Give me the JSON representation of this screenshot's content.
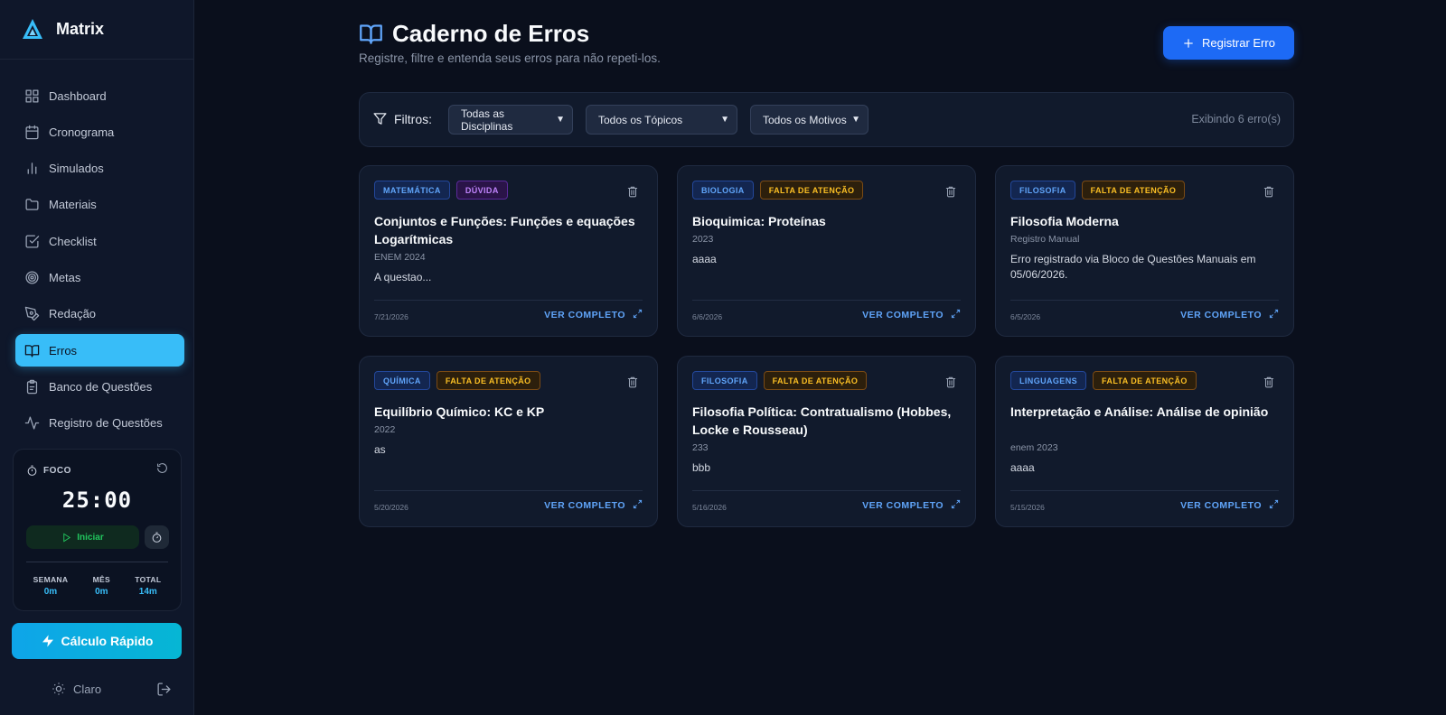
{
  "brand": {
    "name": "Matrix"
  },
  "sidebar": {
    "items": [
      {
        "label": "Dashboard",
        "icon": "dashboard-icon",
        "active": false
      },
      {
        "label": "Cronograma",
        "icon": "calendar-icon",
        "active": false
      },
      {
        "label": "Simulados",
        "icon": "bar-chart-icon",
        "active": false
      },
      {
        "label": "Materiais",
        "icon": "folder-icon",
        "active": false
      },
      {
        "label": "Checklist",
        "icon": "checklist-icon",
        "active": false
      },
      {
        "label": "Metas",
        "icon": "target-icon",
        "active": false
      },
      {
        "label": "Redação",
        "icon": "pen-icon",
        "active": false
      },
      {
        "label": "Erros",
        "icon": "book-icon",
        "active": true
      },
      {
        "label": "Banco de Questões",
        "icon": "clipboard-icon",
        "active": false
      },
      {
        "label": "Registro de Questões",
        "icon": "activity-icon",
        "active": false
      }
    ]
  },
  "focus": {
    "title": "FOCO",
    "timer": "25:00",
    "start_label": "Iniciar",
    "stats": [
      {
        "label": "SEMANA",
        "value": "0m"
      },
      {
        "label": "MÊS",
        "value": "0m"
      },
      {
        "label": "TOTAL",
        "value": "14m"
      }
    ]
  },
  "quick_calc": {
    "label": "Cálculo Rápido"
  },
  "theme": {
    "label": "Claro"
  },
  "page": {
    "title": "Caderno de Erros",
    "subtitle": "Registre, filtre e entenda seus erros para não repeti-los.",
    "register_label": "Registrar Erro"
  },
  "filters": {
    "label": "Filtros:",
    "discipline": "Todas as Disciplinas",
    "topic": "Todos os Tópicos",
    "reason": "Todos os Motivos",
    "count": "Exibindo 6 erro(s)"
  },
  "colors": {
    "accent": "#38bdf8",
    "primary": "#1d6af5",
    "link": "#60a5fa",
    "warning": "#fbbf24"
  },
  "see_more_label": "Ver completo",
  "cards": [
    {
      "subject": "Matemática",
      "reason": "Dúvida",
      "reason_type": "duv",
      "title": "Conjuntos e Funções: Funções e equações Logarítmicas",
      "source": "ENEM 2024",
      "body": "A questao...",
      "date": "7/21/2026"
    },
    {
      "subject": "Biologia",
      "reason": "Falta de atenção",
      "reason_type": "fa",
      "title": "Bioquimica: Proteínas",
      "source": "2023",
      "body": "aaaa",
      "date": "6/6/2026"
    },
    {
      "subject": "Filosofia",
      "reason": "Falta de atenção",
      "reason_type": "fa",
      "title": "Filosofia Moderna",
      "source": "Registro Manual",
      "body": "Erro registrado via Bloco de Questões Manuais em 05/06/2026.",
      "date": "6/5/2026"
    },
    {
      "subject": "Química",
      "reason": "Falta de atenção",
      "reason_type": "fa",
      "title": "Equilíbrio Químico: KC e KP",
      "source": "2022",
      "body": "as",
      "date": "5/20/2026"
    },
    {
      "subject": "Filosofia",
      "reason": "Falta de atenção",
      "reason_type": "fa",
      "title": "Filosofia Política: Contratualismo (Hobbes, Locke e Rousseau)",
      "source": "233",
      "body": "bbb",
      "date": "5/16/2026"
    },
    {
      "subject": "Linguagens",
      "reason": "Falta de atenção",
      "reason_type": "fa",
      "title": "Interpretação e Análise: Análise de opinião",
      "source": "enem 2023",
      "body": "aaaa",
      "date": "5/15/2026"
    }
  ]
}
